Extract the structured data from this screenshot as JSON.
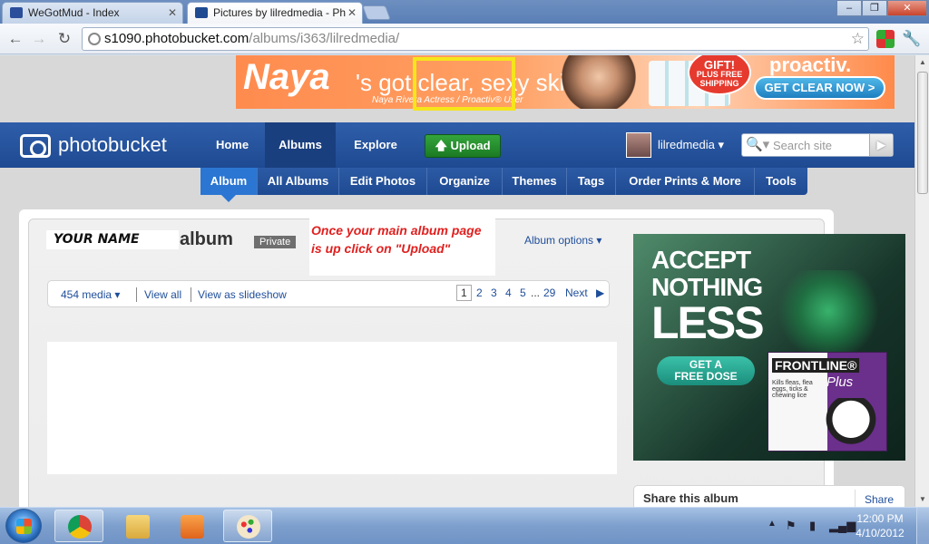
{
  "browser": {
    "tabs": [
      {
        "title": "WeGotMud - Index",
        "active": false
      },
      {
        "title": "Pictures by lilredmedia - Ph",
        "active": true
      }
    ],
    "url_host": "s1090.photobucket.com",
    "url_path": "/albums/i363/lilredmedia/",
    "window_controls": {
      "minimize": "–",
      "maximize": "❐",
      "close": "✕"
    }
  },
  "top_ad": {
    "name": "Naya",
    "tagline": "'s got clear, sexy skin!",
    "subline": "Naya Rivera Actress / Proactiv® User",
    "gift_line1": "GIFT!",
    "gift_line2": "PLUS FREE",
    "gift_line3": "SHIPPING",
    "cta": "GET CLEAR NOW >",
    "brand": "proactiv."
  },
  "site_nav": {
    "logo_text": "photobucket",
    "items": [
      "Home",
      "Albums",
      "Explore"
    ],
    "upload_label": "Upload",
    "upload_icon": "arrow-up-icon",
    "username": "lilredmedia ▾",
    "search_placeholder": "Search site"
  },
  "sub_nav": {
    "items": [
      "Album",
      "All Albums",
      "Edit Photos",
      "Organize",
      "Themes",
      "Tags",
      "Order Prints & More",
      "Tools"
    ]
  },
  "album": {
    "owner_label": "YOUR NAME",
    "title": "album",
    "privacy_badge": "Private",
    "instruction_note": "Once your main album page is up click on \"Upload\"",
    "options_label": "Album options ▾",
    "media_count": "454 media ▾",
    "view_all": "View all",
    "view_slideshow": "View as slideshow",
    "pages": [
      "1",
      "2",
      "3",
      "4",
      "5",
      "...",
      "29"
    ],
    "current_page": "1",
    "next_label": "Next"
  },
  "side_ad": {
    "line1": "ACCEPT",
    "line2": "NOTHING",
    "line3": "LESS",
    "cta_line1": "GET A",
    "cta_line2": "FREE DOSE",
    "product": "FRONTLINE®",
    "product_sub": "Plus",
    "product_desc": "Kills fleas, flea eggs, ticks & chewing lice"
  },
  "share": {
    "title": "Share this album",
    "link": "Share"
  },
  "taskbar": {
    "time": "12:00 PM",
    "date": "4/10/2012"
  }
}
